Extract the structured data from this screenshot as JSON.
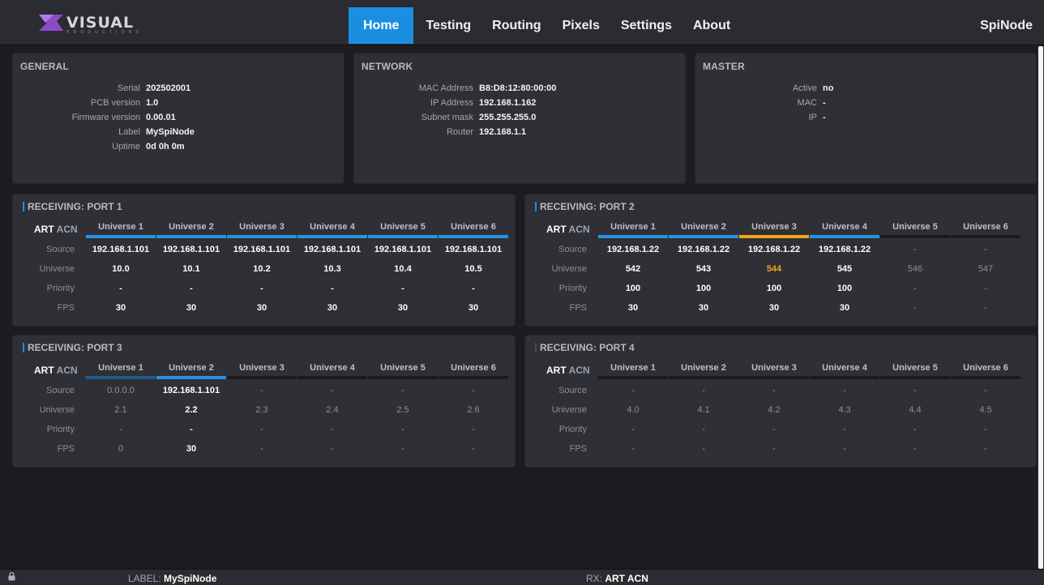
{
  "header": {
    "logo_text": "VISUAL",
    "logo_sub": "PRODUCTIONS",
    "nav": [
      "Home",
      "Testing",
      "Routing",
      "Pixels",
      "Settings",
      "About"
    ],
    "active_nav": "Home",
    "device_name": "SpiNode",
    "accent_color": "#1a8ee0"
  },
  "general": {
    "title": "GENERAL",
    "rows": [
      {
        "key": "Serial",
        "value": "202502001"
      },
      {
        "key": "PCB version",
        "value": "1.0"
      },
      {
        "key": "Firmware version",
        "value": "0.00.01"
      },
      {
        "key": "Label",
        "value": "MySpiNode"
      },
      {
        "key": "Uptime",
        "value": "0d 0h 0m"
      }
    ]
  },
  "network": {
    "title": "NETWORK",
    "rows": [
      {
        "key": "MAC Address",
        "value": "B8:D8:12:80:00:00"
      },
      {
        "key": "IP Address",
        "value": "192.168.1.162"
      },
      {
        "key": "Subnet mask",
        "value": "255.255.255.0"
      },
      {
        "key": "Router",
        "value": "192.168.1.1"
      }
    ]
  },
  "master": {
    "title": "MASTER",
    "rows": [
      {
        "key": "Active",
        "value": "no"
      },
      {
        "key": "MAC",
        "value": "-"
      },
      {
        "key": "IP",
        "value": "-"
      }
    ]
  },
  "row_labels": [
    "Source",
    "Universe",
    "Priority",
    "FPS"
  ],
  "protocol": {
    "art": "ART",
    "acn": "ACN"
  },
  "ports": [
    {
      "title": "RECEIVING: PORT 1",
      "universes": [
        "Universe 1",
        "Universe 2",
        "Universe 3",
        "Universe 4",
        "Universe 5",
        "Universe 6"
      ],
      "bars": [
        "on",
        "on",
        "on",
        "on",
        "on",
        "on"
      ],
      "source": [
        "192.168.1.101",
        "192.168.1.101",
        "192.168.1.101",
        "192.168.1.101",
        "192.168.1.101",
        "192.168.1.101"
      ],
      "universe": [
        "10.0",
        "10.1",
        "10.2",
        "10.3",
        "10.4",
        "10.5"
      ],
      "priority": [
        "-",
        "-",
        "-",
        "-",
        "-",
        "-"
      ],
      "fps": [
        "30",
        "30",
        "30",
        "30",
        "30",
        "30"
      ],
      "active_cols": [
        true,
        true,
        true,
        true,
        true,
        true
      ]
    },
    {
      "title": "RECEIVING: PORT 2",
      "universes": [
        "Universe 1",
        "Universe 2",
        "Universe 3",
        "Universe 4",
        "Universe 5",
        "Universe 6"
      ],
      "bars": [
        "on",
        "on",
        "warn",
        "on",
        "off",
        "off"
      ],
      "source": [
        "192.168.1.22",
        "192.168.1.22",
        "192.168.1.22",
        "192.168.1.22",
        "-",
        "-"
      ],
      "universe": [
        "542",
        "543",
        "544",
        "545",
        "546",
        "547"
      ],
      "priority": [
        "100",
        "100",
        "100",
        "100",
        "-",
        "-"
      ],
      "fps": [
        "30",
        "30",
        "30",
        "30",
        "-",
        "-"
      ],
      "active_cols": [
        true,
        true,
        true,
        true,
        false,
        false
      ],
      "highlight_universe_col": 2
    },
    {
      "title": "RECEIVING: PORT 3",
      "universes": [
        "Universe 1",
        "Universe 2",
        "Universe 3",
        "Universe 4",
        "Universe 5",
        "Universe 6"
      ],
      "bars": [
        "stale",
        "on",
        "off",
        "off",
        "off",
        "off"
      ],
      "source": [
        "0.0.0.0",
        "192.168.1.101",
        "-",
        "-",
        "-",
        "-"
      ],
      "universe": [
        "2.1",
        "2.2",
        "2.3",
        "2.4",
        "2.5",
        "2.6"
      ],
      "priority": [
        "-",
        "-",
        "-",
        "-",
        "-",
        "-"
      ],
      "fps": [
        "0",
        "30",
        "-",
        "-",
        "-",
        "-"
      ],
      "active_cols": [
        false,
        true,
        false,
        false,
        false,
        false
      ]
    },
    {
      "title": "RECEIVING: PORT 4",
      "universes": [
        "Universe 1",
        "Universe 2",
        "Universe 3",
        "Universe 4",
        "Universe 5",
        "Universe 6"
      ],
      "bars": [
        "off",
        "off",
        "off",
        "off",
        "off",
        "off"
      ],
      "source": [
        "-",
        "-",
        "-",
        "-",
        "-",
        "-"
      ],
      "universe": [
        "4.0",
        "4.1",
        "4.2",
        "4.3",
        "4.4",
        "4.5"
      ],
      "priority": [
        "-",
        "-",
        "-",
        "-",
        "-",
        "-"
      ],
      "fps": [
        "-",
        "-",
        "-",
        "-",
        "-",
        "-"
      ],
      "active_cols": [
        false,
        false,
        false,
        false,
        false,
        false
      ]
    }
  ],
  "statusbar": {
    "lock_icon": "lock-icon",
    "label_prefix": "LABEL: ",
    "label_value": "MySpiNode",
    "rx_prefix": "RX: ",
    "rx_value": "ART ACN"
  }
}
